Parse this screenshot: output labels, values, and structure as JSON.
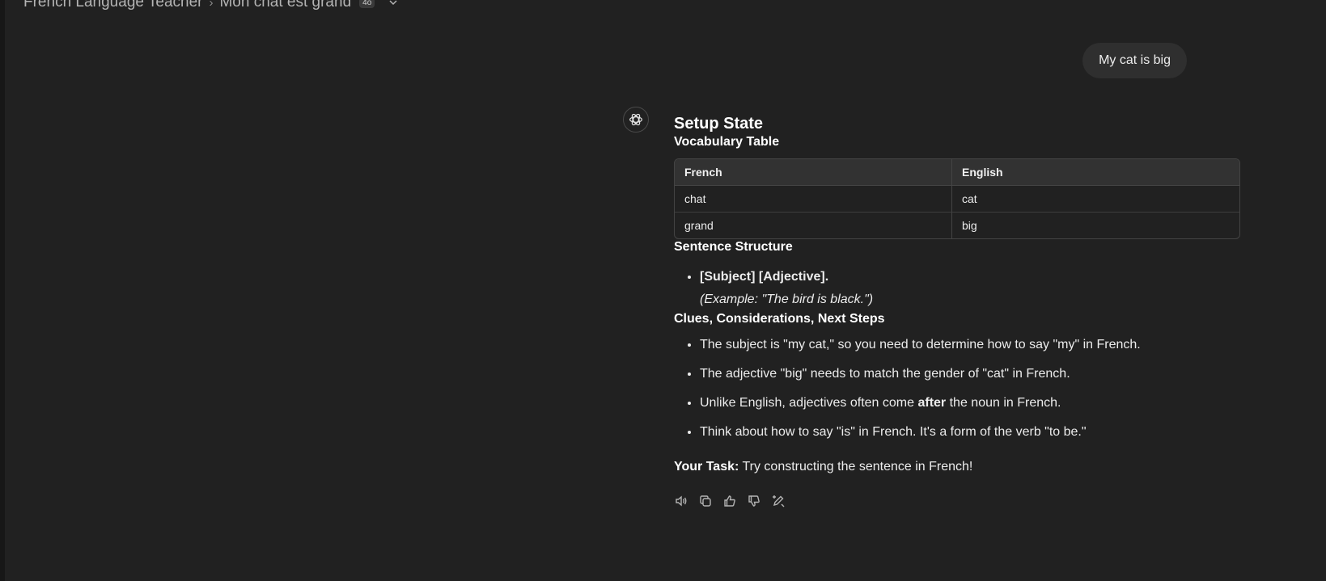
{
  "breadcrumb": {
    "gpt_name": "French Language Teacher",
    "chat_title": "Mon chat est grand",
    "badge": "4o"
  },
  "user_message": "My cat is big",
  "assistant": {
    "title": "Setup State",
    "vocab_title": "Vocabulary Table",
    "vocab_headers": [
      "French",
      "English"
    ],
    "vocab_rows": [
      [
        "chat",
        "cat"
      ],
      [
        "grand",
        "big"
      ]
    ],
    "structure_title": "Sentence Structure",
    "structure_pattern": "[Subject] [Adjective].",
    "structure_example": "(Example: \"The bird is black.\")",
    "clues_title": "Clues, Considerations, Next Steps",
    "clues": [
      "The subject is \"my cat,\" so you need to determine how to say \"my\" in French.",
      "The adjective \"big\" needs to match the gender of \"cat\" in French.",
      {
        "before": "Unlike English, adjectives often come ",
        "bold": "after",
        "after": " the noun in French."
      },
      "Think about how to say \"is\" in French. It's a form of the verb \"to be.\""
    ],
    "task_label": "Your Task:",
    "task_text": " Try constructing the sentence in French!"
  },
  "icons": {
    "avatar": "openai-logo-icon",
    "actions": [
      "read-aloud-icon",
      "copy-icon",
      "thumbs-up-icon",
      "thumbs-down-icon",
      "edit-model-icon"
    ]
  },
  "colors": {
    "background": "#212121",
    "bubble": "#2f2f2f",
    "text": "#ececec"
  }
}
